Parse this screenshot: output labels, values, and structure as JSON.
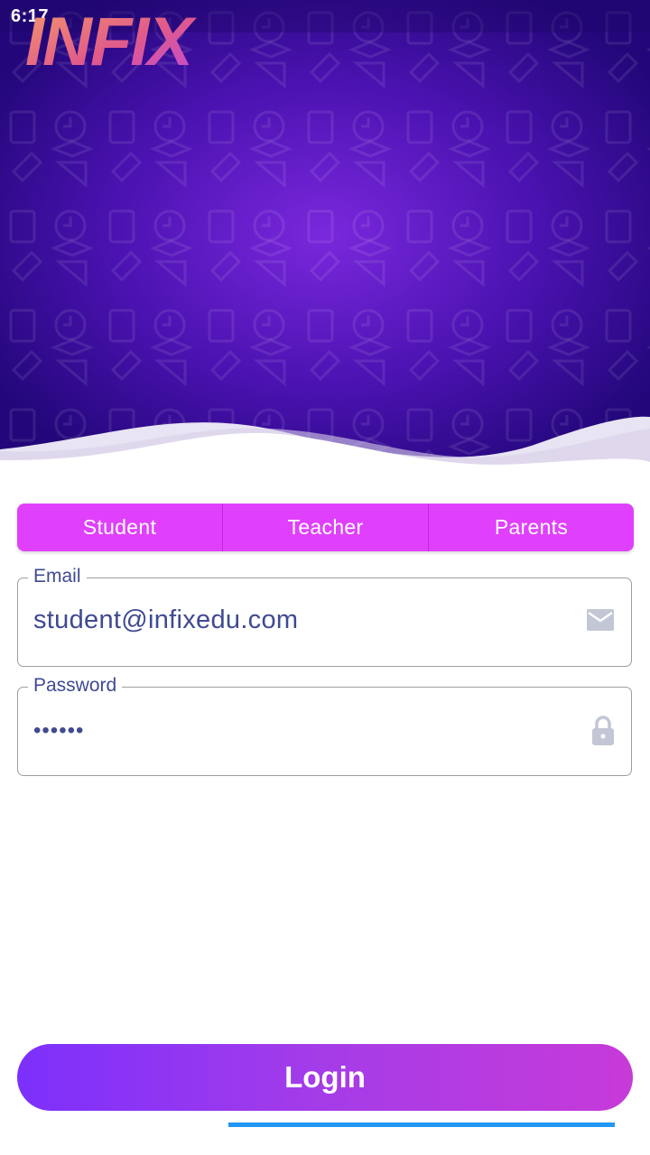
{
  "status_bar": {
    "time": "6:17"
  },
  "logo": {
    "text": "INFIX"
  },
  "tabs": [
    {
      "label": "Student"
    },
    {
      "label": "Teacher"
    },
    {
      "label": "Parents"
    }
  ],
  "email": {
    "label": "Email",
    "value": "student@infixedu.com",
    "icon": "mail-icon"
  },
  "password": {
    "label": "Password",
    "value": "••••••",
    "icon": "lock-icon"
  },
  "login_button": {
    "label": "Login"
  },
  "colors": {
    "header_dark": "#23077a",
    "header_center": "#7a28dc",
    "tab_bg": "#e040fb",
    "text_primary": "#3f4a91",
    "button_start": "#7c30fc",
    "button_end": "#c73ad8",
    "indicator": "#2196f3"
  }
}
